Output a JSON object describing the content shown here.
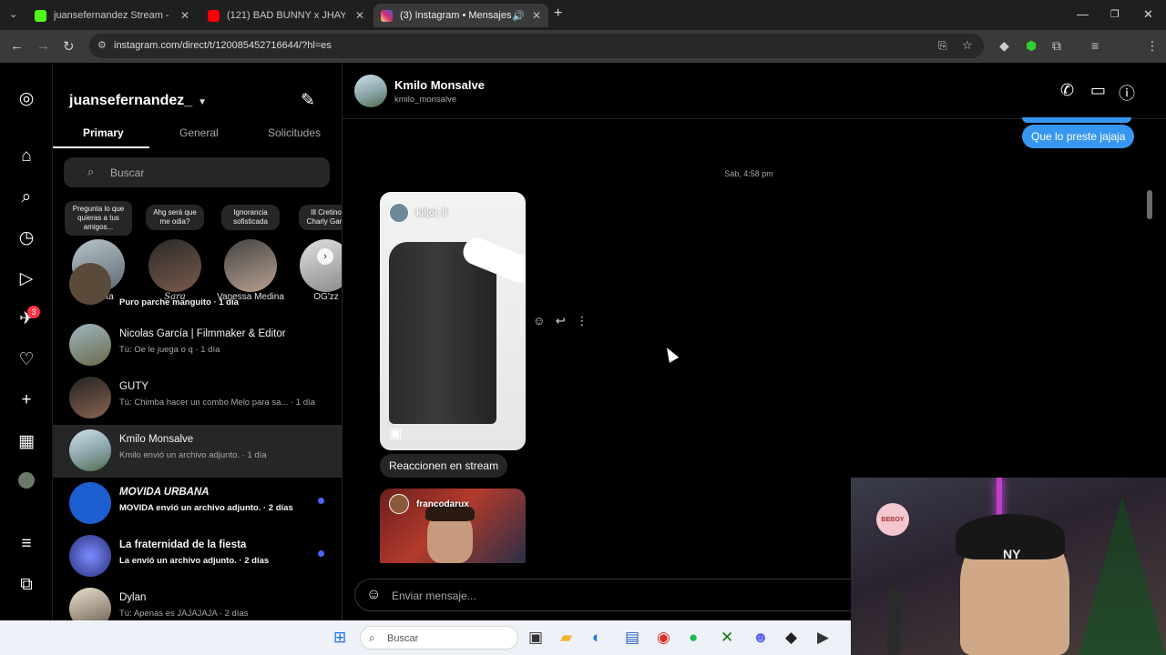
{
  "browser": {
    "tabs": [
      {
        "title": "juansefernandez Stream - Watc",
        "favicon_color": "#53fc18",
        "active": false
      },
      {
        "title": "(121) BAD BUNNY x JHAY CORT",
        "favicon_color": "#ff0000",
        "active": false
      },
      {
        "title": "(3) Instagram • Mensajes",
        "favicon_color": "#d62976",
        "active": true
      }
    ],
    "url": "instagram.com/direct/t/120085452716644/?hl=es"
  },
  "rail": {
    "icons": [
      "instagram-logo-icon",
      "home-icon",
      "search-icon",
      "explore-icon",
      "reels-icon",
      "messages-icon",
      "notifications-icon",
      "create-icon",
      "dashboard-icon",
      "profile-icon",
      "menu-icon",
      "apps-icon"
    ],
    "messages_badge": "3"
  },
  "inbox": {
    "account": "juansefernandez_",
    "tabs": [
      "Primary",
      "General",
      "Solicitudes"
    ],
    "search_placeholder": "Buscar",
    "notes": [
      {
        "bubble": "Pregunta lo que quieras a tus amigos...",
        "name": "Tu nota"
      },
      {
        "bubble": "Ahg será que me odia?",
        "name": "Sara"
      },
      {
        "bubble": "Ignorancia sofisticada",
        "name": "Vanessa Medina"
      },
      {
        "bubble": "Ill Cretino Charly Garc",
        "name": "OG'zz"
      }
    ],
    "conversations": [
      {
        "name": "",
        "preview": "Puro parche manguito · 1 día",
        "bold": false,
        "unread": false,
        "selected": false
      },
      {
        "name": "Nicolas García | Filmmaker & Editor",
        "preview": "Tú: Oe le juega o q · 1 día",
        "bold": false,
        "unread": false,
        "selected": false
      },
      {
        "name": "GUTY",
        "preview": "Tú: Chimba hacer un combo Melo para sa... · 1 día",
        "bold": false,
        "unread": false,
        "selected": false
      },
      {
        "name": "Kmilo Monsalve",
        "preview": "Kmilo envió un archivo adjunto. · 1 día",
        "bold": false,
        "unread": false,
        "selected": true
      },
      {
        "name": "MOVIDA URBANA",
        "preview": "MOVIDA envió un archivo adjunto. · 2 días",
        "bold": true,
        "unread": true,
        "selected": false
      },
      {
        "name": "La fraternidad de la fiesta",
        "preview": "La envió un archivo adjunto. · 2 días",
        "bold": true,
        "unread": true,
        "selected": false
      },
      {
        "name": "Dylan",
        "preview": "Tú: Apenas es JAJAJAJA · 2 días",
        "bold": false,
        "unread": false,
        "selected": false
      }
    ]
  },
  "chat": {
    "contact_name": "Kmilo Monsalve",
    "contact_username": "kmilo_monsalve",
    "outgoing_message": "Que lo preste jajaja",
    "timestamp": "Sáb, 4:58 pm",
    "reel1_user": "kiljoi_ll",
    "reply_text": "Reaccionen en stream",
    "reel2_user": "francodarux",
    "composer_placeholder": "Enviar mensaje..."
  },
  "taskbar": {
    "search_placeholder": "Buscar"
  },
  "webcam": {
    "logo_text": "BEBOY"
  }
}
